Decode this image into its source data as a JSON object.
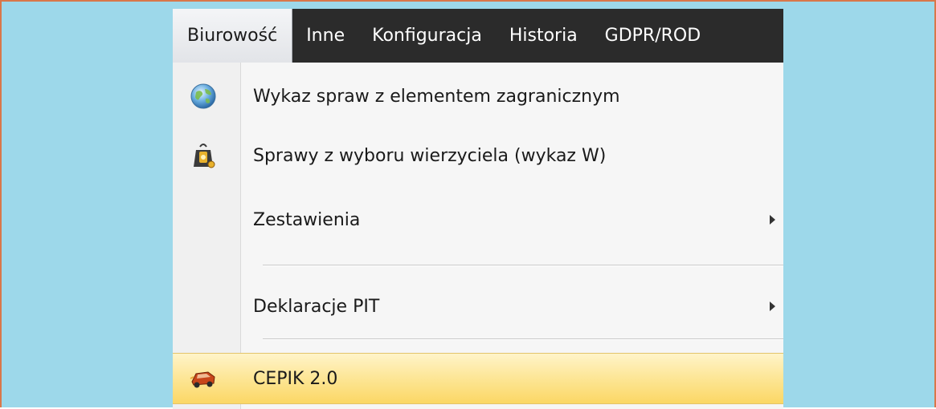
{
  "menubar": {
    "items": [
      {
        "label": "Biurowość",
        "active": true
      },
      {
        "label": "Inne"
      },
      {
        "label": "Konfiguracja"
      },
      {
        "label": "Historia"
      },
      {
        "label": "GDPR/ROD"
      }
    ]
  },
  "dropdown": {
    "items": [
      {
        "label": "Wykaz spraw z elementem zagranicznym",
        "icon": "globe-icon"
      },
      {
        "label": "Sprawy z wyboru wierzyciela (wykaz W)",
        "icon": "bag-icon"
      },
      {
        "label": "Zestawienia",
        "submenu": true
      },
      {
        "label": "Deklaracje PIT",
        "submenu": true
      },
      {
        "label": "CEPIK 2.0",
        "icon": "car-icon",
        "highlighted": true
      }
    ]
  },
  "colors": {
    "background": "#9dd8ea",
    "frame_border": "#d9774a",
    "menubar": "#2b2b2b",
    "highlight": "#fbd765"
  }
}
